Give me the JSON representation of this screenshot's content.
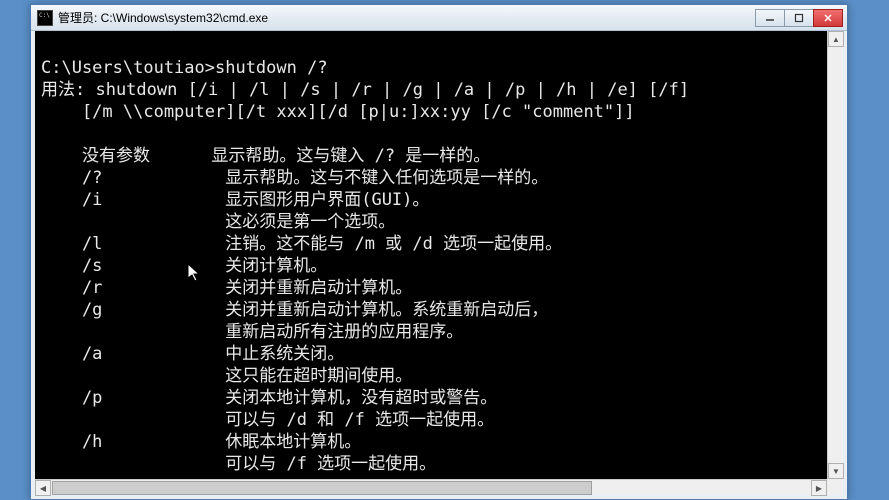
{
  "titlebar": {
    "text": "管理员: C:\\Windows\\system32\\cmd.exe"
  },
  "console": {
    "prompt": "C:\\Users\\toutiao>",
    "command": "shutdown /?",
    "usage1": "用法: shutdown [/i | /l | /s | /r | /g | /a | /p | /h | /e] [/f]",
    "usage2": "    [/m \\\\computer][/t xxx][/d [p|u:]xx:yy [/c \"comment\"]]",
    "params": [
      {
        "flag": "没有参数",
        "desc": "显示帮助。这与键入 /? 是一样的。"
      },
      {
        "flag": "/?",
        "desc": "显示帮助。这与不键入任何选项是一样的。"
      },
      {
        "flag": "/i",
        "desc": "显示图形用户界面(GUI)。"
      },
      {
        "flag": "",
        "desc": "这必须是第一个选项。"
      },
      {
        "flag": "/l",
        "desc": "注销。这不能与 /m 或 /d 选项一起使用。"
      },
      {
        "flag": "/s",
        "desc": "关闭计算机。"
      },
      {
        "flag": "/r",
        "desc": "关闭并重新启动计算机。"
      },
      {
        "flag": "/g",
        "desc": "关闭并重新启动计算机。系统重新启动后，"
      },
      {
        "flag": "",
        "desc": "重新启动所有注册的应用程序。"
      },
      {
        "flag": "/a",
        "desc": "中止系统关闭。"
      },
      {
        "flag": "",
        "desc": "这只能在超时期间使用。"
      },
      {
        "flag": "/p",
        "desc": "关闭本地计算机，没有超时或警告。"
      },
      {
        "flag": "",
        "desc": "可以与 /d 和 /f 选项一起使用。"
      },
      {
        "flag": "/h",
        "desc": "休眠本地计算机。"
      },
      {
        "flag": "",
        "desc": "可以与 /f 选项一起使用。"
      }
    ]
  }
}
